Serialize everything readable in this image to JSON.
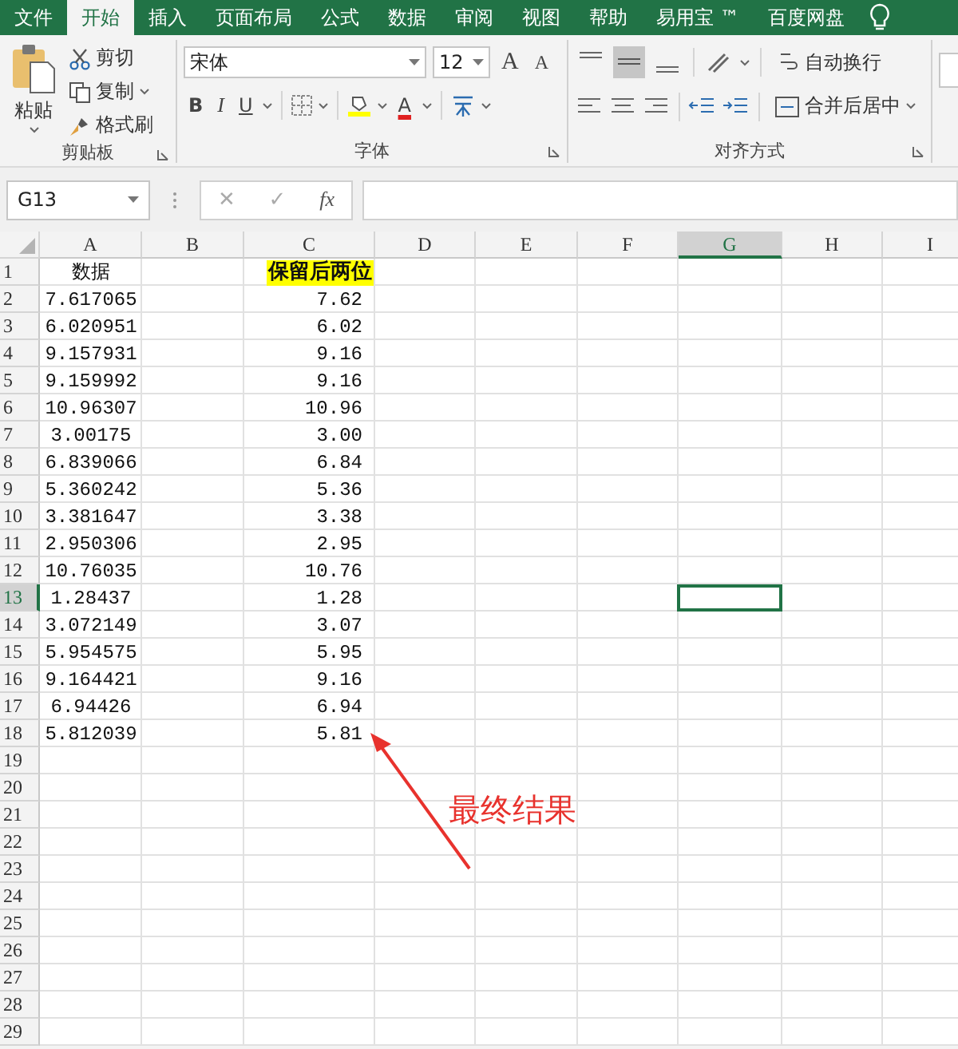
{
  "tabs": [
    {
      "label": "文件",
      "selected": false
    },
    {
      "label": "开始",
      "selected": true
    },
    {
      "label": "插入",
      "selected": false
    },
    {
      "label": "页面布局",
      "selected": false
    },
    {
      "label": "公式",
      "selected": false
    },
    {
      "label": "数据",
      "selected": false
    },
    {
      "label": "审阅",
      "selected": false
    },
    {
      "label": "视图",
      "selected": false
    },
    {
      "label": "帮助",
      "selected": false
    },
    {
      "label": "易用宝 ™",
      "selected": false
    },
    {
      "label": "百度网盘",
      "selected": false
    }
  ],
  "clipboard": {
    "paste": "粘贴",
    "cut": "剪切",
    "copy": "复制",
    "format_painter": "格式刷",
    "title": "剪贴板"
  },
  "font": {
    "name": "宋体",
    "size": "12",
    "grow": "A",
    "shrink": "A",
    "bold": "B",
    "italic": "I",
    "underline": "U",
    "font_color": "A",
    "title": "字体"
  },
  "alignment": {
    "wrap": "自动换行",
    "merge": "合并后居中",
    "title": "对齐方式"
  },
  "formula_bar": {
    "name_box": "G13",
    "cancel": "✕",
    "enter": "✓",
    "function": "fx"
  },
  "columns": [
    {
      "label": "A",
      "selected": false
    },
    {
      "label": "B",
      "selected": false
    },
    {
      "label": "C",
      "selected": false
    },
    {
      "label": "D",
      "selected": false
    },
    {
      "label": "E",
      "selected": false
    },
    {
      "label": "F",
      "selected": false
    },
    {
      "label": "G",
      "selected": true
    },
    {
      "label": "H",
      "selected": false
    },
    {
      "label": "I",
      "selected": false
    }
  ],
  "rows": [
    {
      "number": "1",
      "selected": false,
      "a": "数据",
      "c": "保留后两位",
      "c_highlight": true
    },
    {
      "number": "2",
      "selected": false,
      "a": "7.617065",
      "c": "7.62",
      "c_highlight": false
    },
    {
      "number": "3",
      "selected": false,
      "a": "6.020951",
      "c": "6.02",
      "c_highlight": false
    },
    {
      "number": "4",
      "selected": false,
      "a": "9.157931",
      "c": "9.16",
      "c_highlight": false
    },
    {
      "number": "5",
      "selected": false,
      "a": "9.159992",
      "c": "9.16",
      "c_highlight": false
    },
    {
      "number": "6",
      "selected": false,
      "a": "10.96307",
      "c": "10.96",
      "c_highlight": false
    },
    {
      "number": "7",
      "selected": false,
      "a": "3.00175",
      "c": "3.00",
      "c_highlight": false
    },
    {
      "number": "8",
      "selected": false,
      "a": "6.839066",
      "c": "6.84",
      "c_highlight": false
    },
    {
      "number": "9",
      "selected": false,
      "a": "5.360242",
      "c": "5.36",
      "c_highlight": false
    },
    {
      "number": "10",
      "selected": false,
      "a": "3.381647",
      "c": "3.38",
      "c_highlight": false
    },
    {
      "number": "11",
      "selected": false,
      "a": "2.950306",
      "c": "2.95",
      "c_highlight": false
    },
    {
      "number": "12",
      "selected": false,
      "a": "10.76035",
      "c": "10.76",
      "c_highlight": false
    },
    {
      "number": "13",
      "selected": true,
      "a": "1.28437",
      "c": "1.28",
      "c_highlight": false
    },
    {
      "number": "14",
      "selected": false,
      "a": "3.072149",
      "c": "3.07",
      "c_highlight": false
    },
    {
      "number": "15",
      "selected": false,
      "a": "5.954575",
      "c": "5.95",
      "c_highlight": false
    },
    {
      "number": "16",
      "selected": false,
      "a": "9.164421",
      "c": "9.16",
      "c_highlight": false
    },
    {
      "number": "17",
      "selected": false,
      "a": "6.94426",
      "c": "6.94",
      "c_highlight": false
    },
    {
      "number": "18",
      "selected": false,
      "a": "5.812039",
      "c": "5.81",
      "c_highlight": false
    },
    {
      "number": "19",
      "selected": false
    },
    {
      "number": "20",
      "selected": false
    },
    {
      "number": "21",
      "selected": false
    },
    {
      "number": "22",
      "selected": false
    },
    {
      "number": "23",
      "selected": false
    },
    {
      "number": "24",
      "selected": false
    },
    {
      "number": "25",
      "selected": false
    },
    {
      "number": "26",
      "selected": false
    },
    {
      "number": "27",
      "selected": false
    },
    {
      "number": "28",
      "selected": false
    },
    {
      "number": "29",
      "selected": false
    }
  ],
  "annotation": {
    "text": "最终结果"
  }
}
